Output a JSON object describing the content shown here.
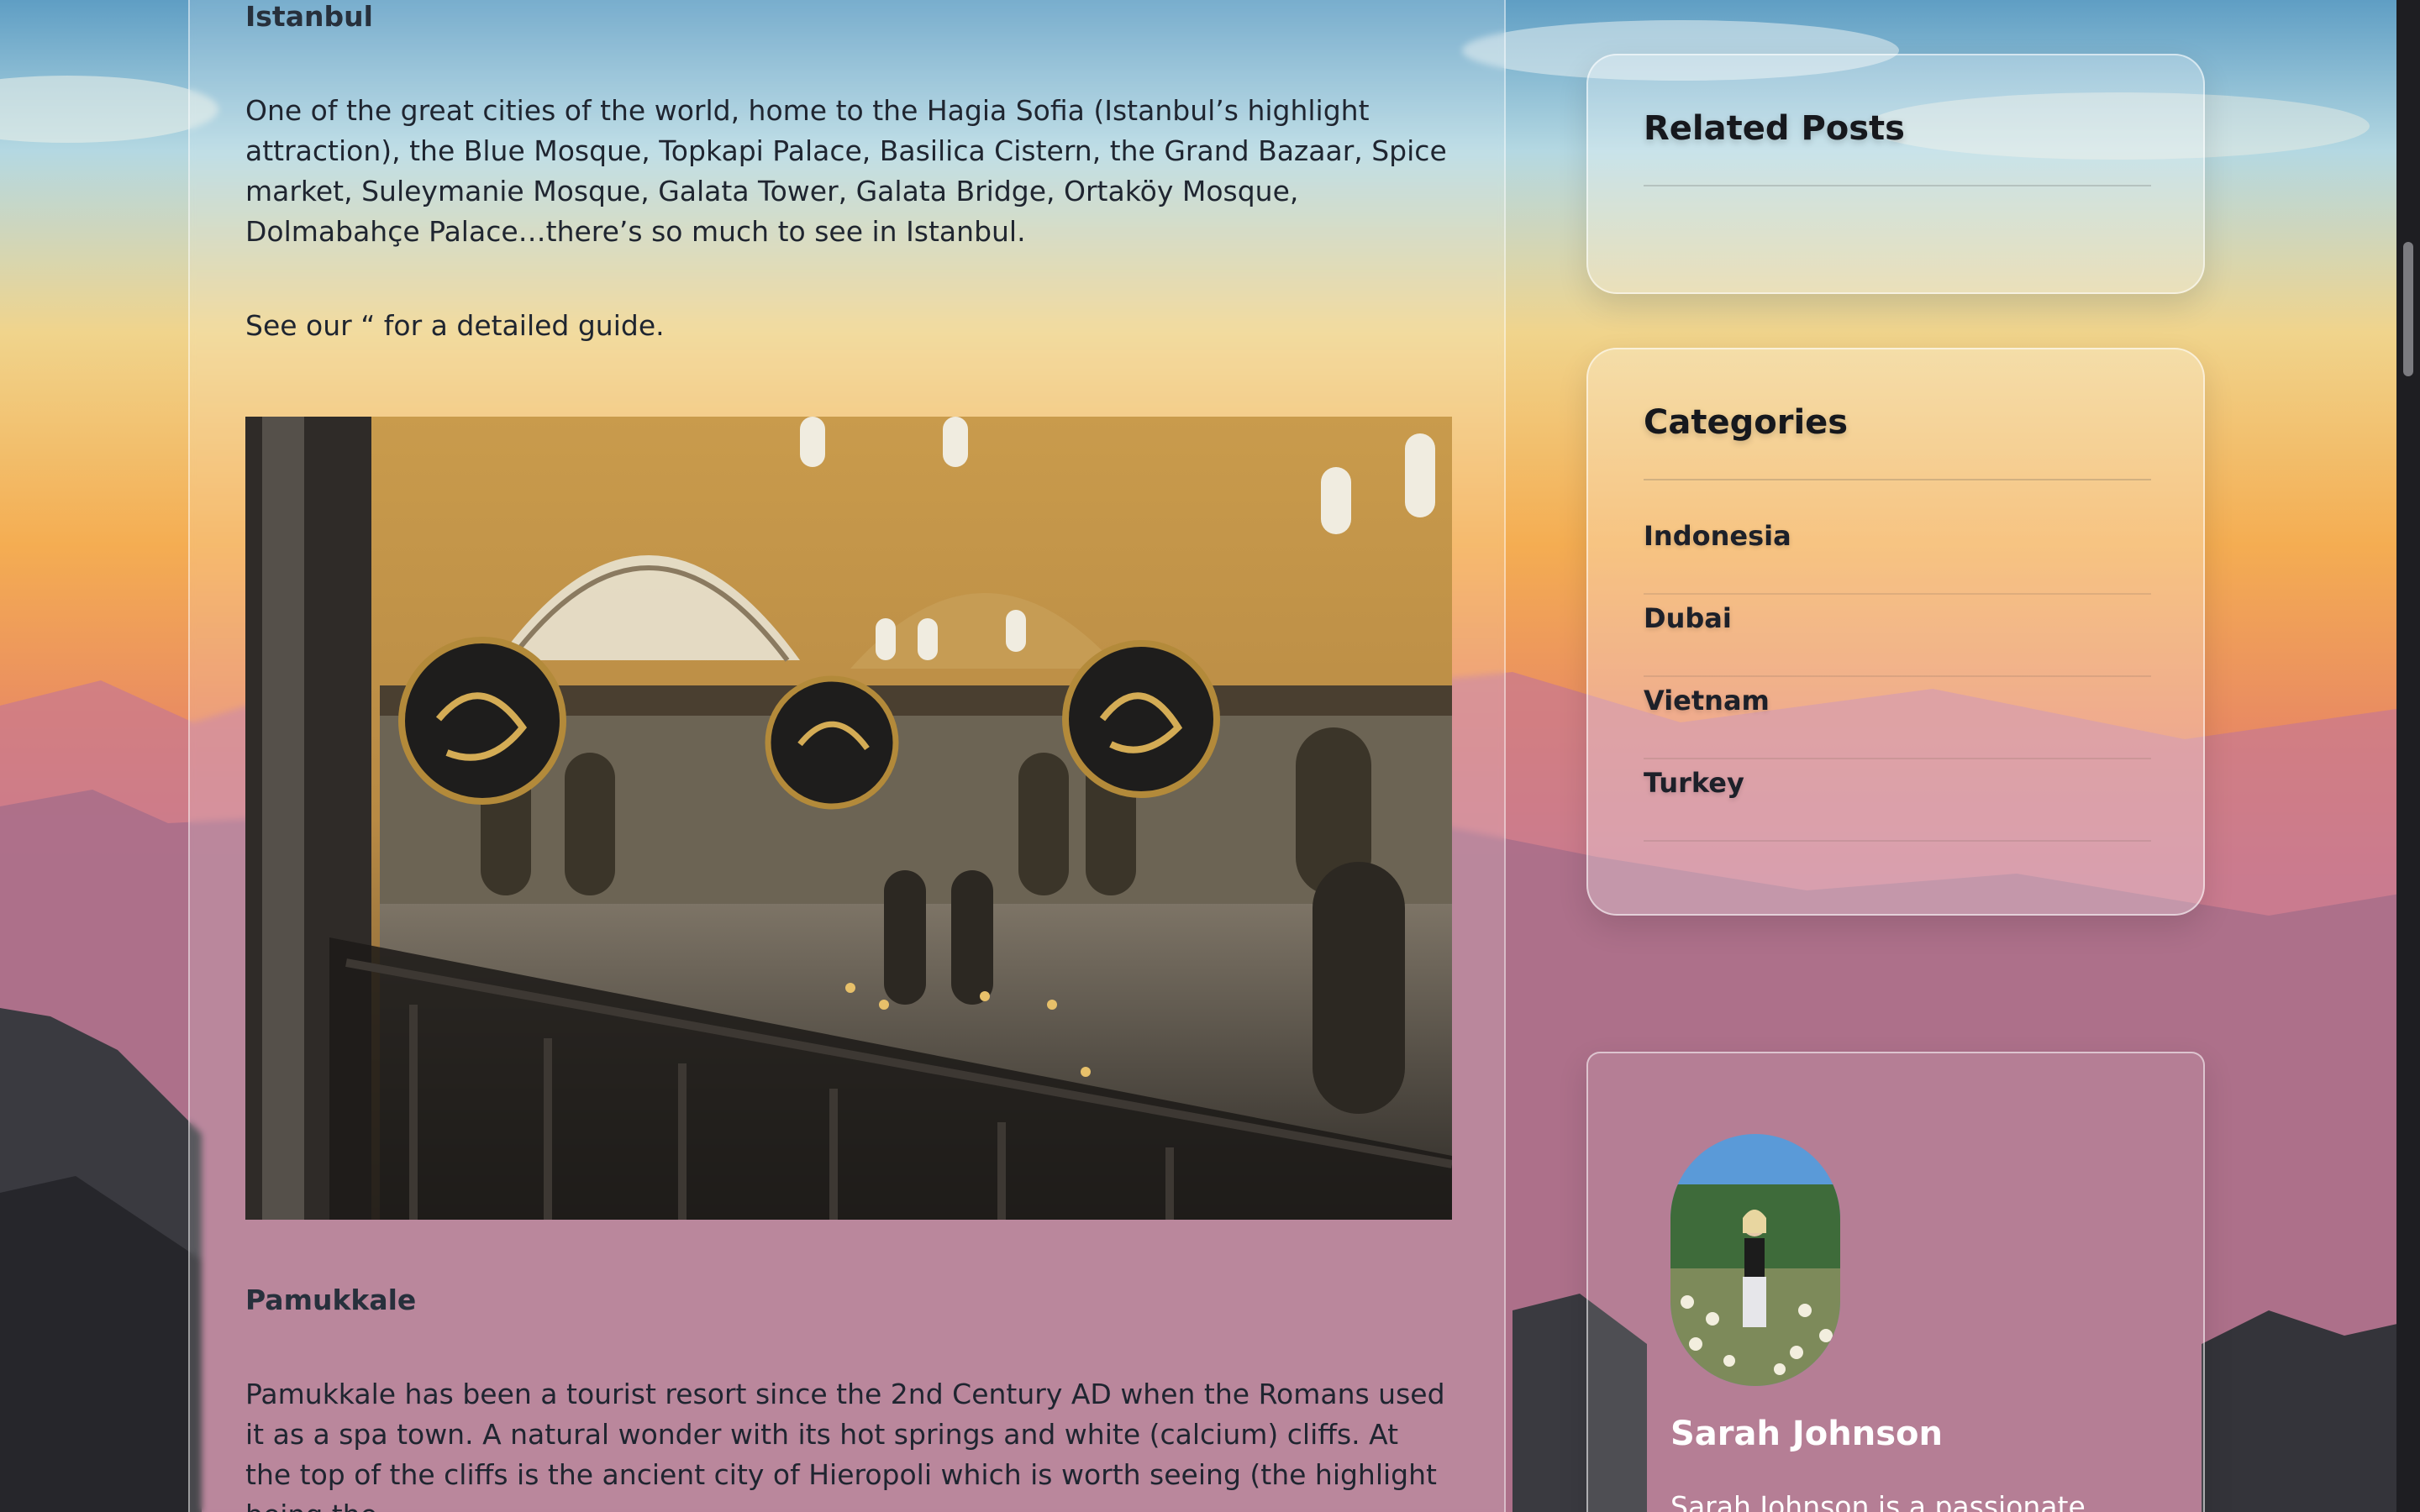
{
  "article": {
    "istanbul_heading": "Istanbul",
    "istanbul_para": "One of the great cities of the world, home to the Hagia Sofia (Istanbul’s highlight attraction), the Blue Mosque, Topkapi Palace, Basilica Cistern, the Grand Bazaar, Spice market, Suleymanie Mosque, Galata Tower, Galata Bridge, Ortaköy Mosque, Dolmabahçe Palace…there’s so much to see in Istanbul.",
    "guide_para": "See our “ for a detailed guide.",
    "pamukkale_heading": "Pamukkale",
    "pamukkale_para": "Pamukkale has been a tourist resort since the 2nd Century AD when the Romans used it as a spa town.  A natural wonder with its hot springs and white (calcium) cliffs. At the top of the cliffs is the ancient city of Hieropoli which is worth seeing (the highlight being the"
  },
  "related": {
    "title": "Related Posts"
  },
  "categories": {
    "title": "Categories",
    "items": [
      {
        "label": "Indonesia"
      },
      {
        "label": "Dubai"
      },
      {
        "label": "Vietnam"
      },
      {
        "label": "Turkey"
      }
    ]
  },
  "author": {
    "name": "Sarah Johnson",
    "bio": "Sarah Johnson is a passionate"
  },
  "colors": {
    "heading": "#27303c",
    "text": "#1f2530",
    "scrollbar": "#1e1e22"
  }
}
